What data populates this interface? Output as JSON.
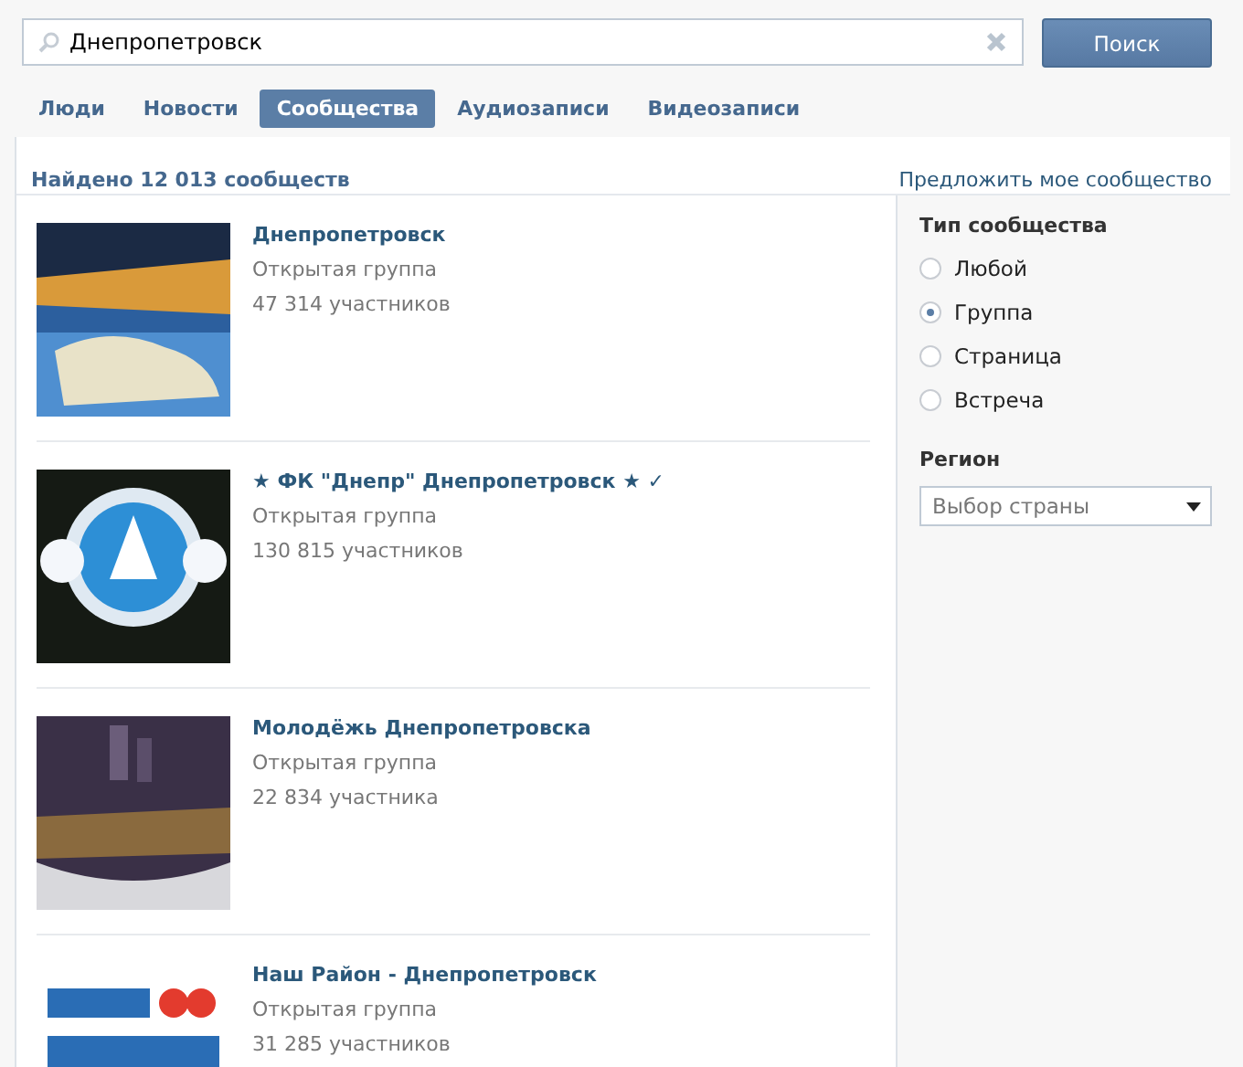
{
  "search": {
    "value": "Днепропетровск",
    "button": "Поиск"
  },
  "tabs": [
    {
      "label": "Люди",
      "selected": false
    },
    {
      "label": "Новости",
      "selected": false
    },
    {
      "label": "Сообщества",
      "selected": true
    },
    {
      "label": "Аудиозаписи",
      "selected": false
    },
    {
      "label": "Видеозаписи",
      "selected": false
    }
  ],
  "results_header": {
    "count": "Найдено 12 013 сообществ",
    "suggest_link": "Предложить мое сообщество"
  },
  "communities": [
    {
      "title": "Днепропетровск",
      "type": "Открытая группа",
      "members": "47 314 участников"
    },
    {
      "title": "★ ФК \"Днепр\" Днепропетровск ★ ✓",
      "type": "Открытая группа",
      "members": "130 815 участников"
    },
    {
      "title": "Молодёжь Днепропетровска",
      "type": "Открытая группа",
      "members": "22 834 участника"
    },
    {
      "title": "Наш Район - Днепропетровск",
      "type": "Открытая группа",
      "members": "31 285 участников"
    }
  ],
  "filters": {
    "type_heading": "Тип сообщества",
    "types": [
      {
        "label": "Любой",
        "selected": false
      },
      {
        "label": "Группа",
        "selected": true
      },
      {
        "label": "Страница",
        "selected": false
      },
      {
        "label": "Встреча",
        "selected": false
      }
    ],
    "region_heading": "Регион",
    "region_select": {
      "placeholder": "Выбор страны"
    }
  }
}
